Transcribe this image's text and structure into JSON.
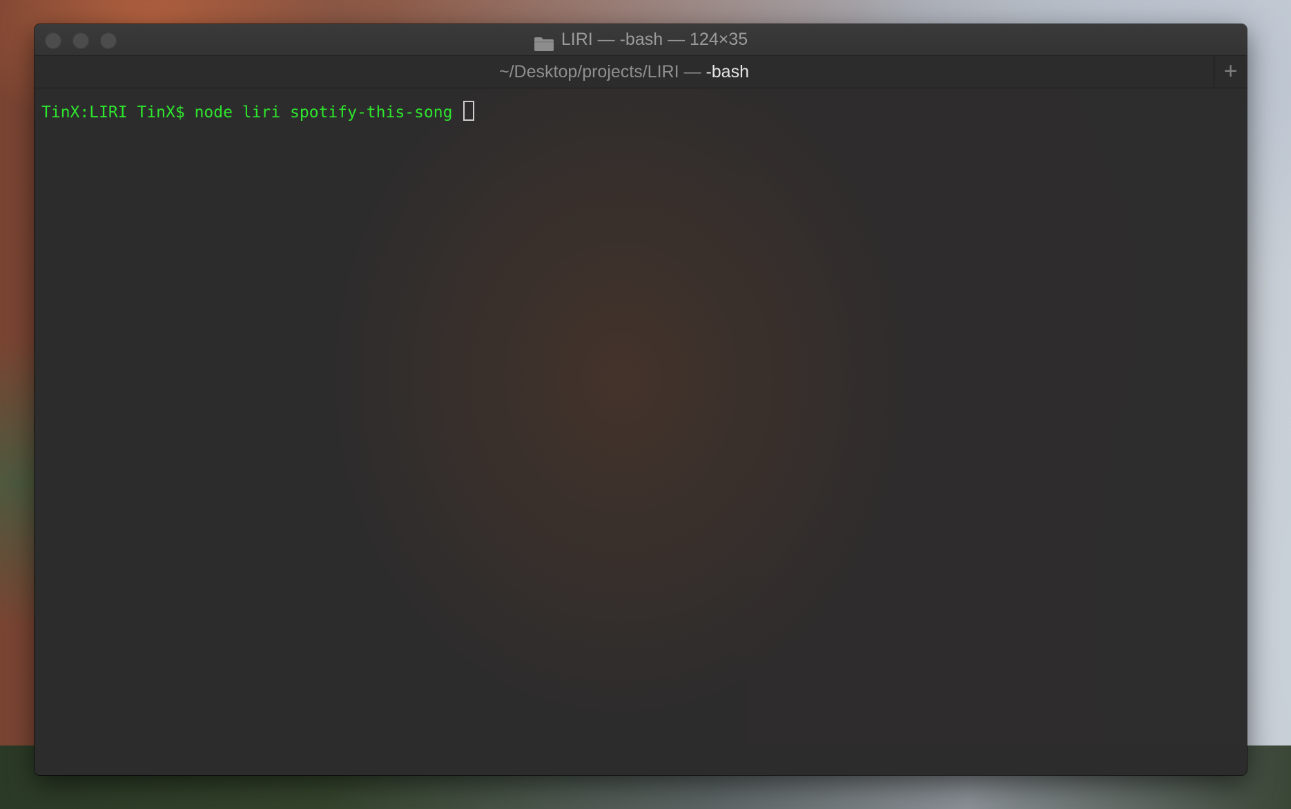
{
  "window": {
    "title": "LIRI — -bash — 124×35",
    "folder_icon": "folder-icon"
  },
  "tab": {
    "path": "~/Desktop/projects/LIRI — ",
    "process": "-bash",
    "new_tab_label": "+"
  },
  "terminal": {
    "prompt": "TinX:LIRI TinX$ ",
    "command": "node liri spotify-this-song ",
    "text_color": "#2ee62e"
  }
}
